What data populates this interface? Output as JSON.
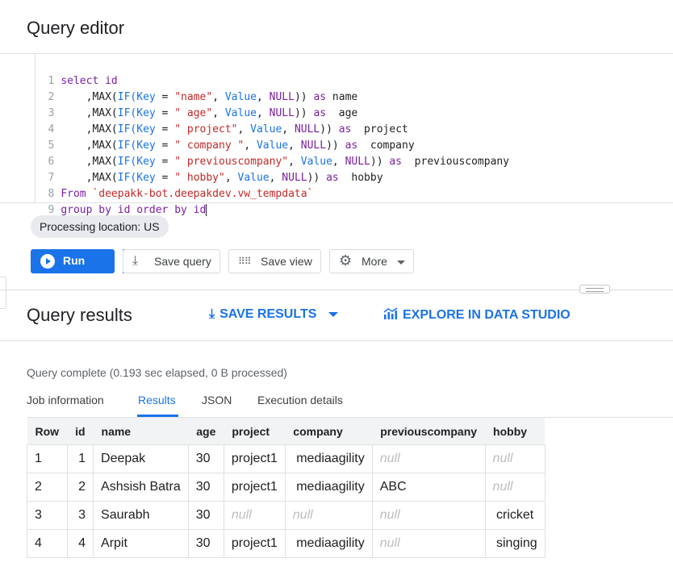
{
  "editor": {
    "title": "Query editor",
    "lines": [
      {
        "n": "1"
      },
      {
        "n": "2"
      },
      {
        "n": "3"
      },
      {
        "n": "4"
      },
      {
        "n": "5"
      },
      {
        "n": "6"
      },
      {
        "n": "7"
      },
      {
        "n": "8"
      },
      {
        "n": "9"
      }
    ],
    "code": {
      "l1": [
        "select id"
      ],
      "l2": [
        ",MAX(",
        "IF(",
        "Key",
        " = ",
        "\"name\"",
        ", ",
        "Value",
        ", ",
        "NULL",
        ")) ",
        "as",
        " name"
      ],
      "l3": [
        ",MAX(",
        "IF(",
        "Key",
        " = ",
        "\" age\"",
        ", ",
        "Value",
        ", ",
        "NULL",
        ")) ",
        "as",
        "  age"
      ],
      "l4": [
        ",MAX(",
        "IF(",
        "Key",
        " = ",
        "\" project\"",
        ", ",
        "Value",
        ", ",
        "NULL",
        ")) ",
        "as",
        "  project"
      ],
      "l5": [
        ",MAX(",
        "IF(",
        "Key",
        " = ",
        "\" company \"",
        ", ",
        "Value",
        ", ",
        "NULL",
        ")) ",
        "as",
        "  company"
      ],
      "l6": [
        ",MAX(",
        "IF(",
        "Key",
        " = ",
        "\" previouscompany\"",
        ", ",
        "Value",
        ", ",
        "NULL",
        ")) ",
        "as",
        "  previouscompany"
      ],
      "l7": [
        ",MAX(",
        "IF(",
        "Key",
        " = ",
        "\" hobby\"",
        ", ",
        "Value",
        ", ",
        "NULL",
        ")) ",
        "as",
        "  hobby"
      ],
      "l8": [
        "From ",
        "`deepakk-bot.deepakdev.vw_tempdata`"
      ],
      "l9": [
        "group by id order by id"
      ]
    }
  },
  "processing_location": "Processing location: US",
  "toolbar": {
    "run_label": "Run",
    "save_query_label": "Save query",
    "save_view_label": "Save view",
    "more_label": "More"
  },
  "results": {
    "title": "Query results",
    "save_results_label": "SAVE RESULTS",
    "explore_label": "EXPLORE IN DATA STUDIO",
    "status": "Query complete (0.193 sec elapsed, 0 B processed)",
    "tabs": [
      "Job information",
      "Results",
      "JSON",
      "Execution details"
    ],
    "active_tab": "Results",
    "columns": [
      "Row",
      "id",
      "name",
      "age",
      "project",
      "company",
      "previouscompany",
      "hobby"
    ],
    "rows": [
      [
        "1",
        "1",
        "Deepak",
        "30",
        "project1",
        " mediaagility",
        "null",
        "null"
      ],
      [
        "2",
        "2",
        "Ashsish Batra",
        "30",
        "project1",
        " mediaagility",
        "ABC",
        "null"
      ],
      [
        "3",
        "3",
        "Saurabh",
        "30",
        "null",
        "null",
        "null",
        " cricket"
      ],
      [
        "4",
        "4",
        "Arpit",
        "30",
        "project1",
        " mediaagility",
        "null",
        " singing"
      ]
    ]
  },
  "colors": {
    "accent": "#1a73e8",
    "keyword": "#7b1fa2",
    "string": "#c62828",
    "null_text": "#bdbdbd"
  },
  "icons": {
    "run": "play-circle-icon",
    "save_query": "download-icon",
    "save_view": "grid-dots-icon",
    "more": "gear-icon",
    "save_results": "download-icon",
    "explore": "chart-icon"
  }
}
